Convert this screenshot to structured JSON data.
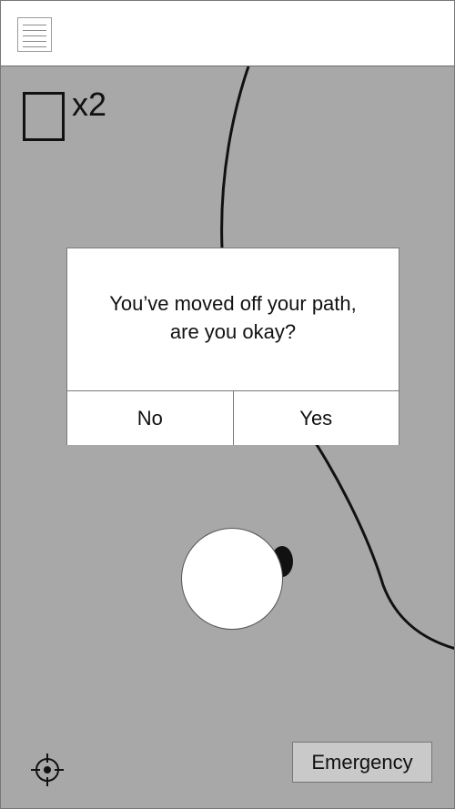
{
  "header": {
    "menu_icon": "hamburger-menu-icon"
  },
  "counter": {
    "icon": "empty-square-icon",
    "text": "x2"
  },
  "map": {
    "path_color": "#111111",
    "background_color": "#a8a8a8"
  },
  "dialog": {
    "message_line1": "You’ve moved off your path,",
    "message_line2": "are you okay?",
    "no_label": "No",
    "yes_label": "Yes"
  },
  "controls": {
    "locate_icon": "crosshair-locate-icon",
    "emergency_label": "Emergency"
  }
}
